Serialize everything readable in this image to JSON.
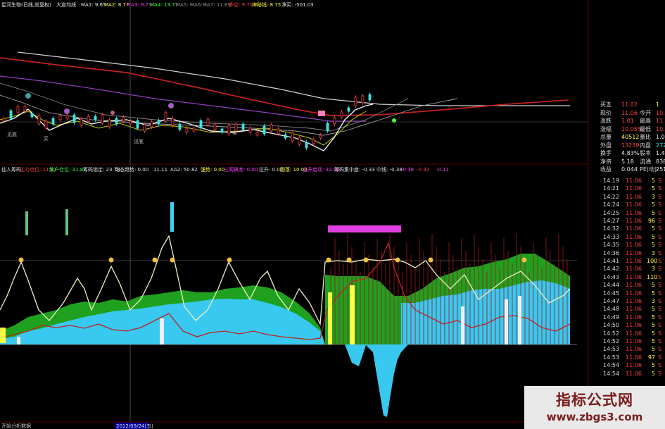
{
  "top_header": {
    "stock": "星河生物(日线,前复权)",
    "indicator": "大道均线",
    "ma1": "MA1: 9.65",
    "ma2": "MA2: 8.77",
    "ma3": "MA3: 9.73",
    "ma4": "MA4: 13.77",
    "ma5": "MA5: -",
    "ma6": "MA6: -",
    "ma7": "MA7: 11.69",
    "misc1": "多空: 9.71",
    "turn": "神秘线: 8.75",
    "net": "净买: -501.03"
  },
  "mid_header": {
    "name": "仙人筹码",
    "a1": "主力仓位: 11.11",
    "a2": "散户仓位: 31.87",
    "a3": "筹码锁定: 23.78",
    "a4": "动态趋势: 0.00",
    "a5": "11.11",
    "a6": "AA2: 50.82",
    "a7": "强势: 0.00",
    "a8": "三网擒龙: 0.00",
    "a9": "拉升: 0.00",
    "a10": "回落: 10.00",
    "a11": "主升启动: 32.00",
    "a12": "筹码集中度: -0.33",
    "a13": "中线: -0.38",
    "a14": "-0.38",
    "a15": "-0.32",
    "a16": "-0.11"
  },
  "kline_labels": {
    "low1": "见底",
    "low2": "见底",
    "mark1": "买",
    "mark2": "卖"
  },
  "bottom_axis": {
    "left_text": "开始分析数据",
    "date": "2012/09/24(五)"
  },
  "quote": {
    "rows": [
      {
        "l1": "买五",
        "v1": "11.02",
        "l2": "",
        "v2": "1",
        "c1": "red",
        "c2": "yel"
      },
      {
        "l1": "现价",
        "v1": "11.06",
        "l2": "今开",
        "v2": "10.5",
        "c1": "red",
        "c2": "red"
      },
      {
        "l1": "涨跌",
        "v1": "1.01",
        "l2": "最高",
        "v2": "11.0",
        "c1": "red",
        "c2": "red"
      },
      {
        "l1": "涨幅",
        "v1": "10.05%",
        "l2": "最低",
        "v2": "10.4",
        "c1": "red",
        "c2": "red"
      },
      {
        "l1": "总量",
        "v1": "40512",
        "l2": "量比",
        "v2": "1.0",
        "c1": "yel",
        "c2": "white"
      },
      {
        "l1": "外盘",
        "v1": "13239",
        "l2": "内盘",
        "v2": "2727",
        "c1": "red",
        "c2": "cyan"
      },
      {
        "l1": "换手",
        "v1": "4.83%",
        "l2": "股本",
        "v2": "1.47",
        "c1": "white",
        "c2": "white"
      },
      {
        "l1": "净资",
        "v1": "5.18",
        "l2": "流通",
        "v2": "8381",
        "c1": "white",
        "c2": "white"
      },
      {
        "l1": "收益",
        "v1": "0.044",
        "l2": "PE(动)",
        "v2": "251",
        "c1": "white",
        "c2": "white"
      }
    ]
  },
  "ticks": [
    {
      "time": "14:19",
      "price": "11.06",
      "vol": "5",
      "dir": "S"
    },
    {
      "time": "14:21",
      "price": "11.06",
      "vol": "5",
      "dir": "S"
    },
    {
      "time": "14:22",
      "price": "11.06",
      "vol": "3",
      "dir": "S"
    },
    {
      "time": "14:24",
      "price": "11.06",
      "vol": "5",
      "dir": "S"
    },
    {
      "time": "14:25",
      "price": "11.06",
      "vol": "5",
      "dir": "S"
    },
    {
      "time": "14:27",
      "price": "11.06",
      "vol": "96",
      "dir": "S"
    },
    {
      "time": "14:32",
      "price": "11.06",
      "vol": "5",
      "dir": "S"
    },
    {
      "time": "14:33",
      "price": "11.06",
      "vol": "5",
      "dir": "S"
    },
    {
      "time": "14:35",
      "price": "11.06",
      "vol": "5",
      "dir": "S"
    },
    {
      "time": "14:36",
      "price": "11.06",
      "vol": "3",
      "dir": "S"
    },
    {
      "time": "14:41",
      "price": "11.06",
      "vol": "100",
      "dir": "S"
    },
    {
      "time": "14:42",
      "price": "11.06",
      "vol": "3",
      "dir": "S"
    },
    {
      "time": "14:43",
      "price": "11.06",
      "vol": "110",
      "dir": "S"
    },
    {
      "time": "14:44",
      "price": "11.06",
      "vol": "5",
      "dir": "S"
    },
    {
      "time": "14:45",
      "price": "11.06",
      "vol": "5",
      "dir": "S"
    },
    {
      "time": "14:47",
      "price": "11.06",
      "vol": "3",
      "dir": "S"
    },
    {
      "time": "14:48",
      "price": "11.06",
      "vol": "5",
      "dir": "S"
    },
    {
      "time": "14:49",
      "price": "11.06",
      "vol": "5",
      "dir": "S"
    },
    {
      "time": "14:50",
      "price": "11.06",
      "vol": "5",
      "dir": "S"
    },
    {
      "time": "14:52",
      "price": "11.06",
      "vol": "5",
      "dir": "S"
    },
    {
      "time": "14:52",
      "price": "11.06",
      "vol": "5",
      "dir": "S"
    },
    {
      "time": "14:53",
      "price": "11.06",
      "vol": "5",
      "dir": "S"
    },
    {
      "time": "14:53",
      "price": "11.06",
      "vol": "97",
      "dir": "S"
    },
    {
      "time": "14:54",
      "price": "11.06",
      "vol": "5",
      "dir": "S"
    },
    {
      "time": "14:54",
      "price": "11.06",
      "vol": "5",
      "dir": "S"
    }
  ],
  "watermark": {
    "title": "指标公式网",
    "url": "www.zbgs3.com"
  }
}
